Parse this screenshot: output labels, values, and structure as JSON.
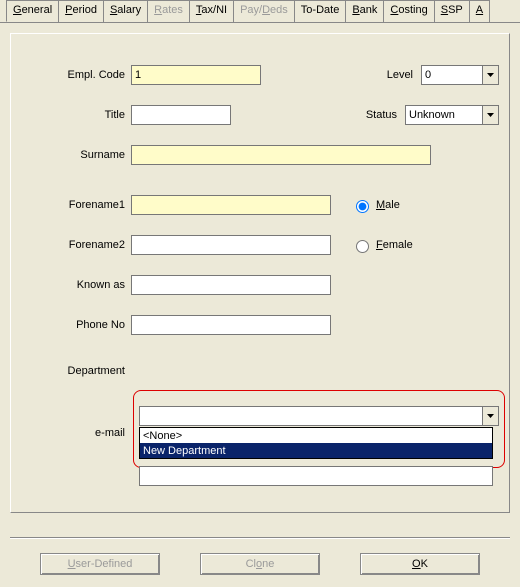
{
  "tabs": {
    "general": {
      "label": "General",
      "hotkey": "G",
      "disabled": false,
      "active": true
    },
    "period": {
      "label": "Period",
      "hotkey": "P",
      "disabled": false
    },
    "salary": {
      "label": "Salary",
      "hotkey": "S",
      "disabled": false
    },
    "rates": {
      "label": "Rates",
      "hotkey": "R",
      "disabled": true
    },
    "taxni": {
      "label": "Tax/NI",
      "hotkey": "T",
      "disabled": false
    },
    "paydeds": {
      "label": "Pay/Deds",
      "hotkey": "",
      "disabled": true
    },
    "todate": {
      "label": "To-Date",
      "hotkey": "",
      "disabled": false
    },
    "bank": {
      "label": "Bank",
      "hotkey": "B",
      "disabled": false
    },
    "costing": {
      "label": "Costing",
      "hotkey": "C",
      "disabled": false
    },
    "ssp": {
      "label": "SSP",
      "hotkey": "S",
      "disabled": false
    },
    "a": {
      "label": "A",
      "hotkey": "A",
      "disabled": false
    }
  },
  "labels": {
    "empl_code": "Empl. Code",
    "level": "Level",
    "title": "Title",
    "status": "Status",
    "surname": "Surname",
    "forename1": "Forename1",
    "forename2": "Forename2",
    "known_as": "Known as",
    "phone_no": "Phone No",
    "department": "Department",
    "email": "e-mail"
  },
  "fields": {
    "empl_code": "1",
    "level": "0",
    "title": "",
    "status": "Unknown",
    "surname": "",
    "forename1": "",
    "forename2": "",
    "known_as": "",
    "phone_no": "",
    "department": "",
    "email": ""
  },
  "gender": {
    "male_label": "Male",
    "female_label": "Female",
    "selected": "male"
  },
  "department_options": {
    "opt0": "<None>",
    "opt1": "New Department"
  },
  "buttons": {
    "user_defined": "User-Defined",
    "clone": "Clone",
    "ok": "OK"
  }
}
